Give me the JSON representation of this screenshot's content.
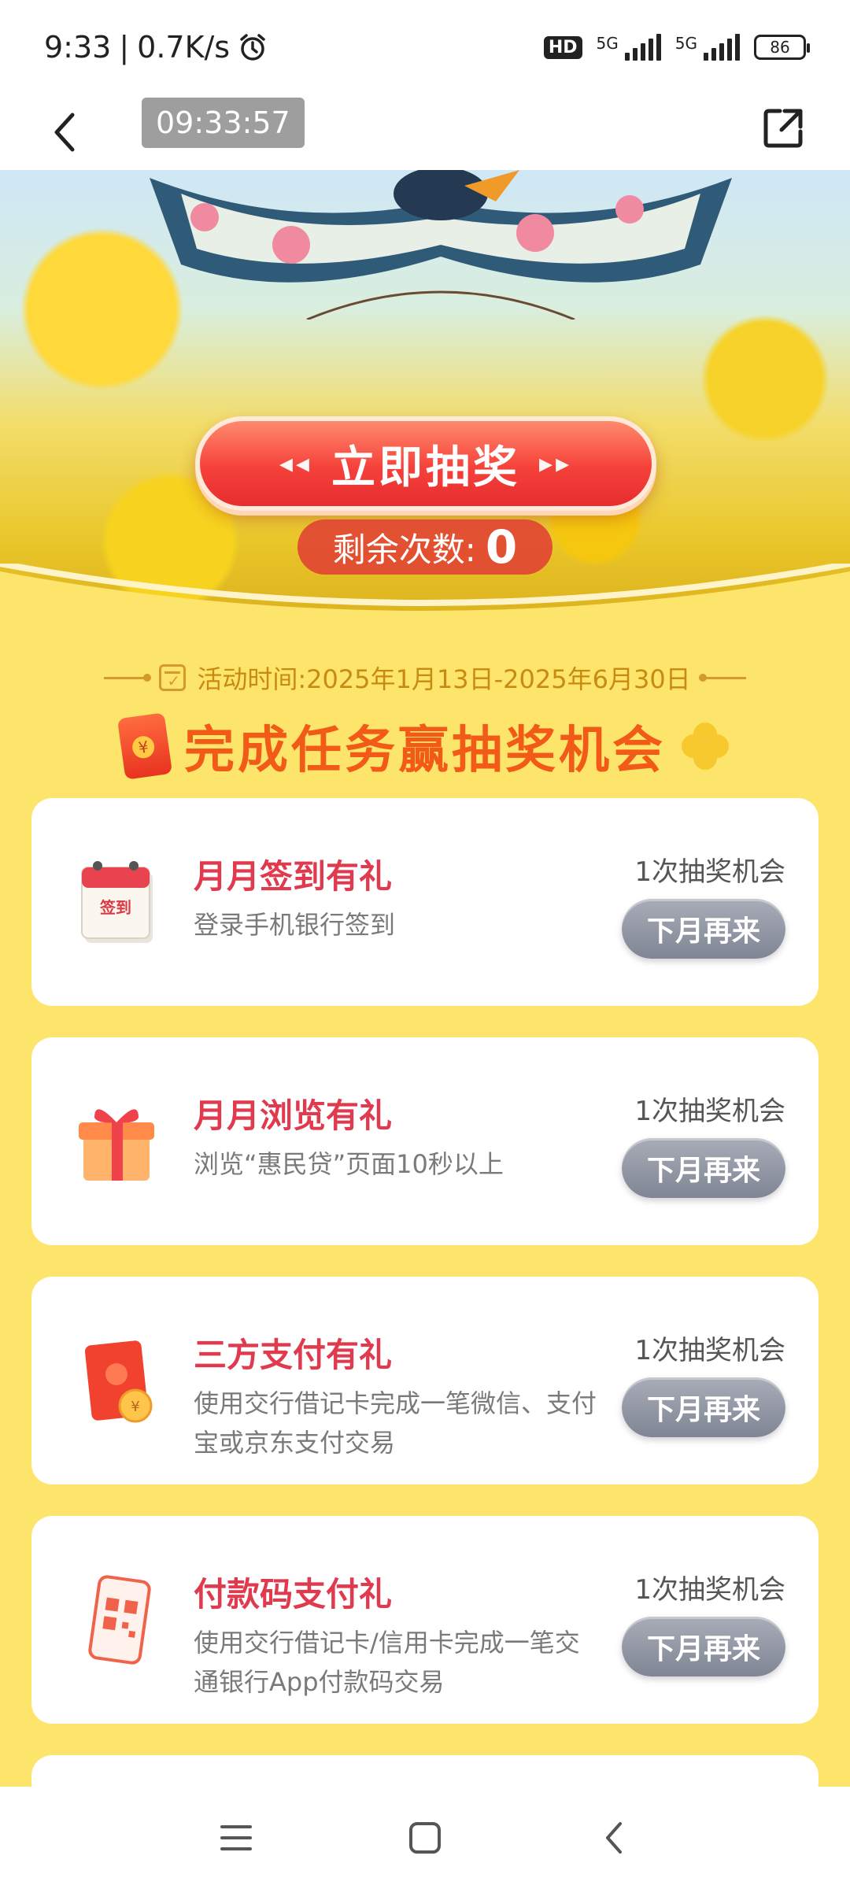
{
  "status_bar": {
    "time": "9:33",
    "network_speed": "0.7K/s",
    "hd_label": "HD",
    "signal_1_label": "5G",
    "signal_2_label": "5G",
    "battery": "86"
  },
  "header": {
    "timer": "09:33:57"
  },
  "banner": {
    "draw_button": "立即抽奖",
    "remaining_label": "剩余次数:",
    "remaining_count": "0"
  },
  "activity": {
    "time_text": "活动时间:2025年1月13日-2025年6月30日",
    "section_title": "完成任务赢抽奖机会"
  },
  "tasks": [
    {
      "title": "月月签到有礼",
      "desc": "登录手机银行签到",
      "chance": "1次抽奖机会",
      "button": "下月再来",
      "icon": "calendar-icon"
    },
    {
      "title": "月月浏览有礼",
      "desc": "浏览“惠民贷”页面10秒以上",
      "chance": "1次抽奖机会",
      "button": "下月再来",
      "icon": "gift-box-icon"
    },
    {
      "title": "三方支付有礼",
      "desc": "使用交行借记卡完成一笔微信、支付宝或京东支付交易",
      "chance": "1次抽奖机会",
      "button": "下月再来",
      "icon": "red-envelope-icon"
    },
    {
      "title": "付款码支付礼",
      "desc": "使用交行借记卡/信用卡完成一笔交通银行App付款码交易",
      "chance": "1次抽奖机会",
      "button": "下月再来",
      "icon": "qr-phone-icon"
    }
  ],
  "icons": {
    "calendar_label": "签到"
  },
  "colors": {
    "page_bg": "#fde46b",
    "title_red": "#e03a4e",
    "section_orange": "#f25a18",
    "draw_button_red": "#f5413a",
    "disabled_button": "#8f94a0"
  }
}
